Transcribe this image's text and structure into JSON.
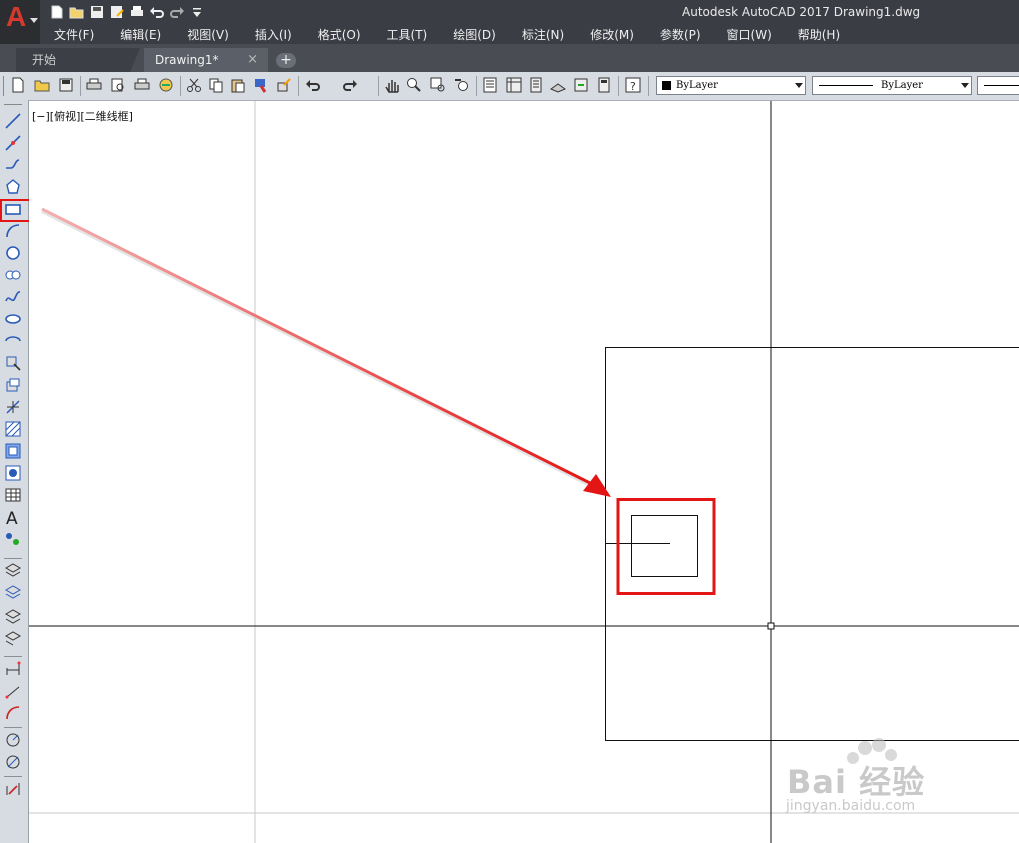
{
  "app": {
    "logo_letter": "A",
    "title": "Autodesk AutoCAD 2017     Drawing1.dwg"
  },
  "quick_access": [
    "new-icon",
    "open-icon",
    "save-icon",
    "save-as-icon",
    "print-icon",
    "undo-icon",
    "redo-icon",
    "customize-icon"
  ],
  "menu": {
    "items": [
      "文件(F)",
      "编辑(E)",
      "视图(V)",
      "插入(I)",
      "格式(O)",
      "工具(T)",
      "绘图(D)",
      "标注(N)",
      "修改(M)",
      "参数(P)",
      "窗口(W)",
      "帮助(H)"
    ]
  },
  "tabs": {
    "start": "开始",
    "drawing": "Drawing1*",
    "close": "×",
    "add": "+"
  },
  "properties": {
    "color": "ByLayer",
    "linetype": "ByLayer"
  },
  "viewport": {
    "label": "[−][俯视][二维线框]"
  },
  "left_tools": [
    "line-icon",
    "construction-line-icon",
    "polyline-icon",
    "polygon-icon",
    "rectangle-icon",
    "arc-icon",
    "circle-icon",
    "revision-cloud-icon",
    "spline-icon",
    "ellipse-icon",
    "ellipse-arc-icon",
    "insert-block-icon",
    "make-block-icon",
    "point-icon",
    "hatch-icon",
    "gradient-icon",
    "region-icon",
    "table-icon",
    "multiline-text-icon",
    "add-selected-icon"
  ],
  "colors": {
    "highlight": "#e41515",
    "chrome_dark": "#3a3d44",
    "toolbar": "#d7dbe2"
  },
  "watermark": {
    "text": "Bai 经验",
    "url": "jingyan.baidu.com"
  }
}
